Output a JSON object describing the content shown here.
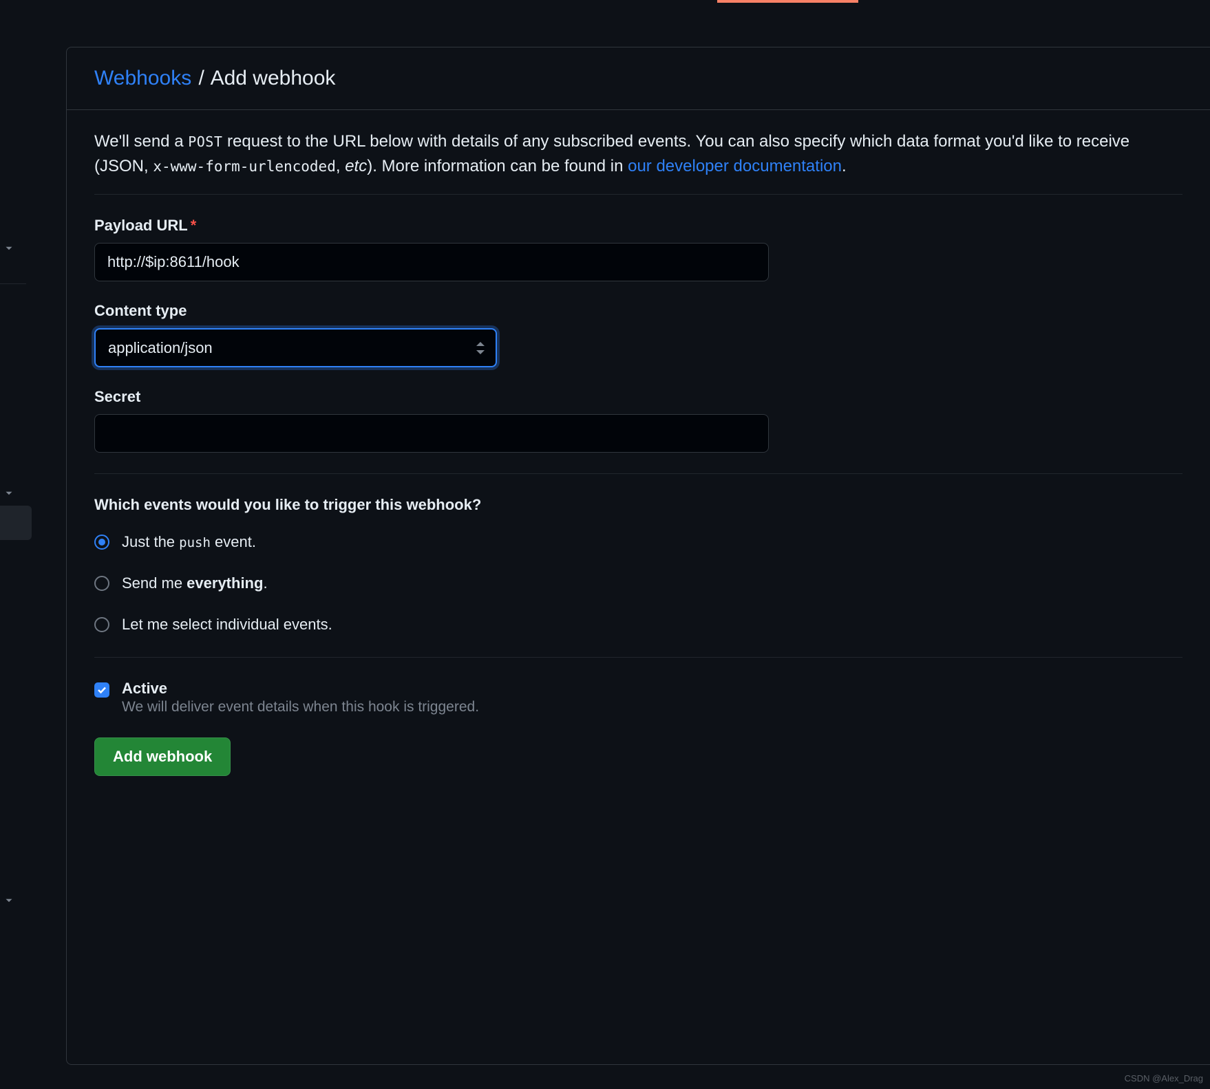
{
  "breadcrumb": {
    "parent": "Webhooks",
    "separator": "/",
    "current": "Add webhook"
  },
  "intro": {
    "part1": "We'll send a ",
    "method": "POST",
    "part2": " request to the URL below with details of any subscribed events. You can also specify which data format you'd like to receive (JSON, ",
    "encoding": "x-www-form-urlencoded",
    "part3": ", ",
    "etc": "etc",
    "part4": "). More information can be found in ",
    "doclink": "our developer documentation",
    "part5": "."
  },
  "form": {
    "payload_url": {
      "label": "Payload URL",
      "value": "http://$ip:8611/hook"
    },
    "content_type": {
      "label": "Content type",
      "value": "application/json"
    },
    "secret": {
      "label": "Secret",
      "value": ""
    }
  },
  "events": {
    "heading": "Which events would you like to trigger this webhook?",
    "options": {
      "push": {
        "prefix": "Just the ",
        "code": "push",
        "suffix": " event.",
        "selected": true
      },
      "everything": {
        "prefix": "Send me ",
        "bold": "everything",
        "suffix": ".",
        "selected": false
      },
      "individual": {
        "text": "Let me select individual events.",
        "selected": false
      }
    }
  },
  "active": {
    "label": "Active",
    "description": "We will deliver event details when this hook is triggered.",
    "checked": true
  },
  "submit_label": "Add webhook",
  "watermark": "CSDN @Alex_Drag"
}
